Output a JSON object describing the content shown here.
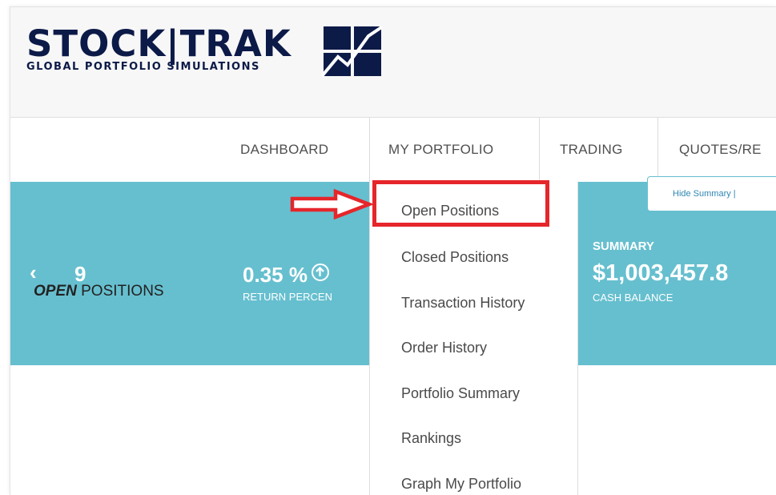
{
  "logo": {
    "word": "STOCK|TRAK",
    "tagline": "GLOBAL PORTFOLIO SIMULATIONS",
    "brand_color": "#0c1a48"
  },
  "nav": {
    "items": [
      "DASHBOARD",
      "MY PORTFOLIO",
      "TRADING",
      "QUOTES/RE"
    ]
  },
  "banner": {
    "background": "#66bfcf",
    "prev_arrow": "‹",
    "count": "9",
    "return_value": "0.35 %",
    "return_label": "RETURN PERCEN",
    "summary_heading": "SUMMARY",
    "cash_value": "$1,003,457.8",
    "cash_label": "CASH BALANCE",
    "hide_summary": "Hide Summary   |"
  },
  "dropdown": {
    "items": [
      "Open Positions",
      "Closed Positions",
      "Transaction History",
      "Order History",
      "Portfolio Summary",
      "Rankings",
      "Graph My Portfolio"
    ],
    "highlight_color": "#e5262b"
  },
  "content": {
    "title_bold": "OPEN",
    "title_rest": " POSITIONS"
  }
}
